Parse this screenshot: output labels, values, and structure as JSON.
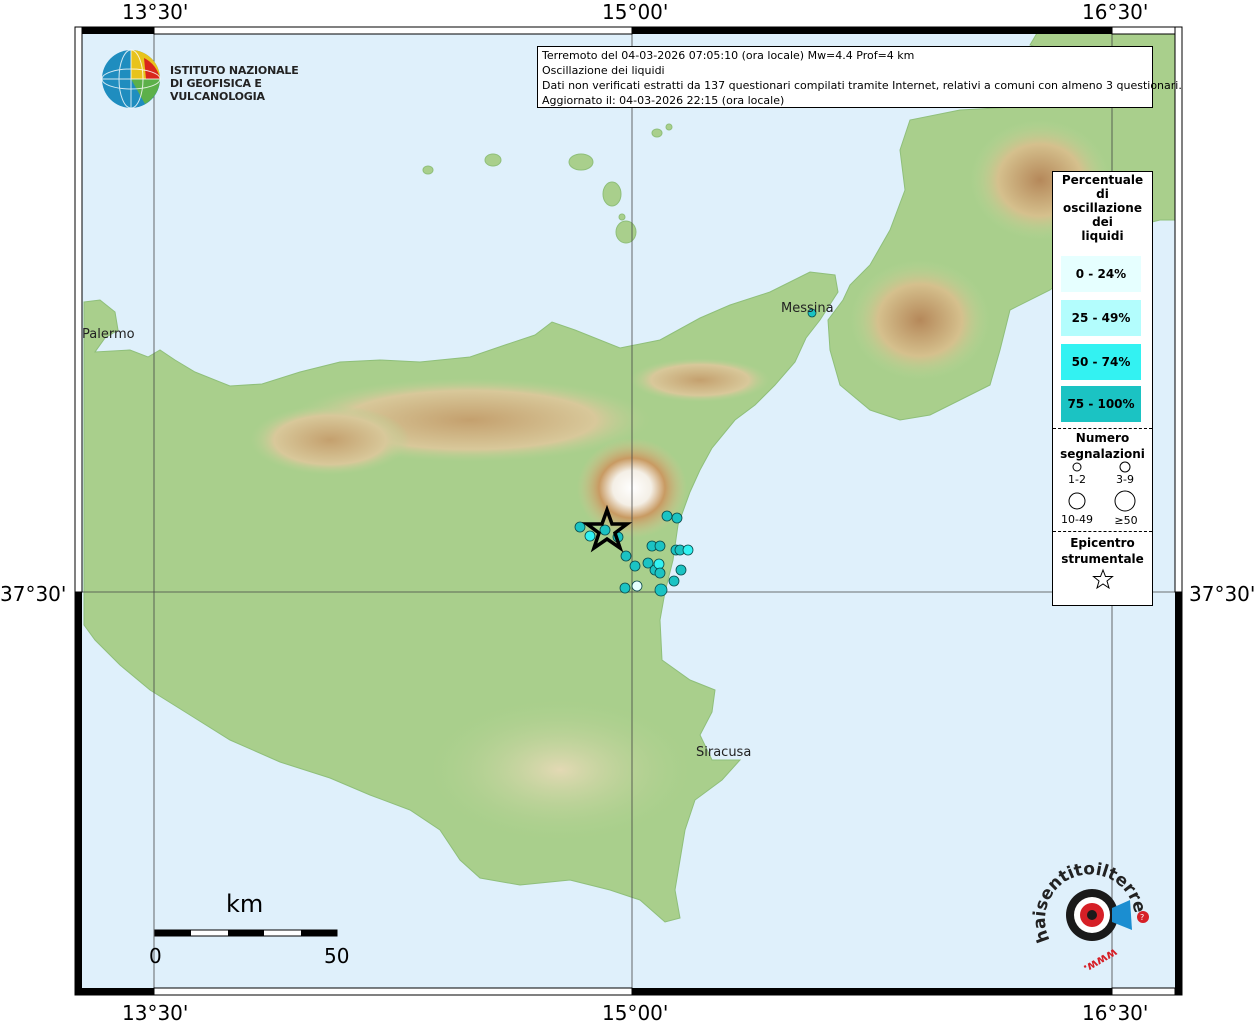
{
  "header": {
    "line1": "Terremoto del 04-03-2026 07:05:10 (ora locale) Mw=4.4 Prof=4 km",
    "line2": "Oscillazione dei liquidi",
    "line3": "Dati non verificati estratti da 137 questionari compilati tramite Internet, relativi a comuni con almeno 3 questionari.",
    "line4": "Aggiornato il: 04-03-2026 22:15 (ora locale)"
  },
  "logo": {
    "line1": "ISTITUTO NAZIONALE",
    "line2": "DI GEOFISICA E VULCANOLOGIA"
  },
  "coords": {
    "top_left": "13°30'",
    "top_mid": "15°00'",
    "top_right": "16°30'",
    "bottom_left": "13°30'",
    "bottom_mid": "15°00'",
    "bottom_right": "16°30'",
    "left_lat": "37°30'",
    "right_lat": "37°30'"
  },
  "places": {
    "palermo": "Palermo",
    "messina": "Messina",
    "siracusa": "Siracusa"
  },
  "legend": {
    "title_lines": [
      "Percentuale",
      "di",
      "oscillazione",
      "dei",
      "liquidi"
    ],
    "classes": [
      {
        "label": "0 - 24%",
        "color": "#e6ffff"
      },
      {
        "label": "25 - 49%",
        "color": "#b3fdfd"
      },
      {
        "label": "50 - 74%",
        "color": "#33f2f2"
      },
      {
        "label": "75 - 100%",
        "color": "#1bc3c3"
      }
    ],
    "count_title": "Numero segnalazioni",
    "count_title_line1": "Numero",
    "count_title_line2": "segnalazioni",
    "count_classes": [
      "1-2",
      "3-9",
      "10-49",
      "≥50"
    ],
    "epicenter_line1": "Epicentro",
    "epicenter_line2": "strumentale"
  },
  "scale": {
    "unit": "km",
    "min": "0",
    "max": "50"
  },
  "watermark": {
    "text": "haisentitoilterremoto.it",
    "site": "www."
  },
  "colors": {
    "sea": "#dff0fb",
    "land": "#a9cf8c",
    "hills": "#d8c89a",
    "mountains": "#b58a55",
    "marker_stroke": "#0a4a4a"
  }
}
